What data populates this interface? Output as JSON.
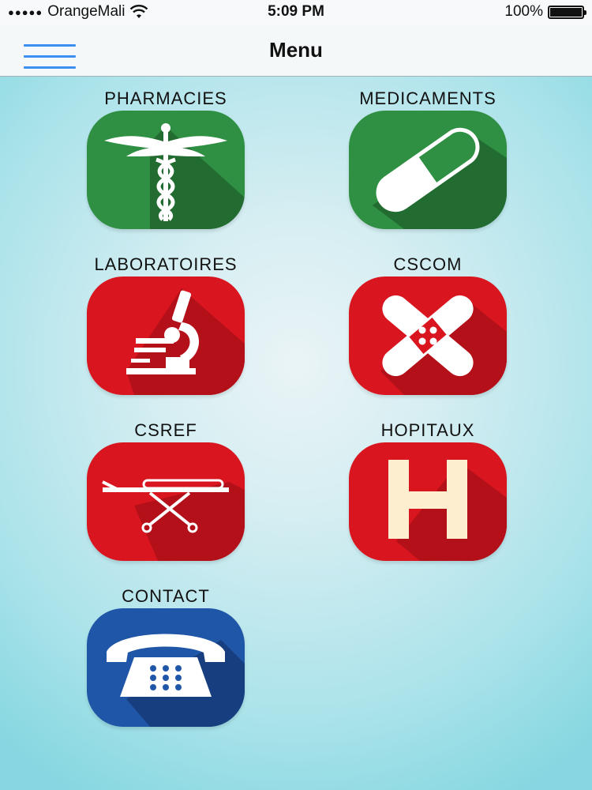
{
  "status_bar": {
    "signal_dots": "●●●●●",
    "carrier": "OrangeMali",
    "time": "5:09 PM",
    "battery_text": "100%",
    "battery_level": 1.0
  },
  "nav": {
    "title": "Menu",
    "menu_icon": "hamburger-menu-icon"
  },
  "colors": {
    "green": "#2f8f43",
    "red": "#d9161f",
    "blue": "#1f56a8",
    "hamburger": "#3b8ff0"
  },
  "menu_items": [
    {
      "label": "PHARMACIES",
      "icon": "caduceus-icon",
      "color": "green"
    },
    {
      "label": "MEDICAMENTS",
      "icon": "pill-capsule-icon",
      "color": "green"
    },
    {
      "label": "LABORATOIRES",
      "icon": "microscope-icon",
      "color": "red"
    },
    {
      "label": "CSCOM",
      "icon": "bandage-icon",
      "color": "red"
    },
    {
      "label": "CSREF",
      "icon": "stretcher-icon",
      "color": "red"
    },
    {
      "label": "HOPITAUX",
      "icon": "hospital-h-icon",
      "color": "red"
    },
    {
      "label": "CONTACT",
      "icon": "telephone-icon",
      "color": "blue"
    }
  ]
}
